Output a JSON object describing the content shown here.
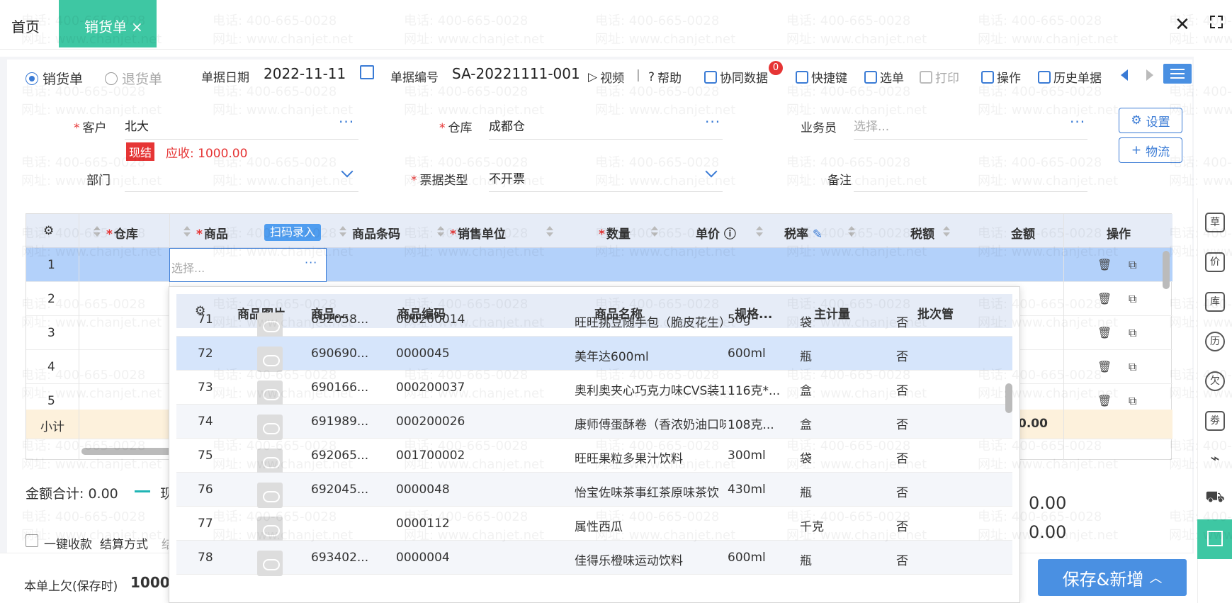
{
  "tabs": {
    "home": "首页",
    "active": "销货单",
    "close": "×"
  },
  "window": {
    "close": "✕"
  },
  "doc_type": {
    "sale": "销货单",
    "return": "退货单"
  },
  "header": {
    "date_label": "单据日期",
    "date": "2022-11-11",
    "no_label": "单据编号",
    "no": "SA-20221111-001"
  },
  "toolbar": {
    "video": "视频",
    "sep": "|",
    "help": "帮助",
    "sync": "协同数据",
    "sync_badge": "0",
    "shortcut": "快捷键",
    "pick": "选单",
    "print": "打印",
    "ops": "操作",
    "history": "历史单据"
  },
  "form": {
    "customer_label": "客户",
    "customer": "北大",
    "warehouse_label": "仓库",
    "warehouse": "成都仓",
    "salesman_label": "业务员",
    "salesman_ph": "选择...",
    "cash_tag": "现结",
    "receivable": "应收: 1000.00",
    "dept_label": "部门",
    "invoice_label": "票据类型",
    "invoice": "不开票",
    "remark_label": "备注",
    "settings_btn": "设置",
    "logistics_btn": "物流"
  },
  "grid": {
    "headers": {
      "warehouse": "仓库",
      "product": "商品",
      "barcode": "商品条码",
      "unit": "销售单位",
      "qty": "数量",
      "price": "单价",
      "tax_rate": "税率",
      "tax": "税额",
      "amount": "金额",
      "ops": "操作"
    },
    "scan_btn": "扫码录入",
    "input_ph": "选择...",
    "rows": [
      "1",
      "2",
      "3",
      "4",
      "5"
    ],
    "subtotal": "小计",
    "subtotal_amount": "0.00"
  },
  "dropdown": {
    "headers": {
      "image": "商品图片",
      "barcode": "商品...",
      "code": "商品编码",
      "name": "商品名称",
      "spec": "规格...",
      "unit": "主计量",
      "batch": "批次管"
    },
    "rows": [
      {
        "no": "71",
        "barcode": "692058...",
        "code": "000200014",
        "name": "旺旺挑豆随手包（脆皮花生）",
        "spec": "50g",
        "unit": "袋",
        "batch": "否"
      },
      {
        "no": "72",
        "barcode": "690690...",
        "code": "0000045",
        "name": "美年达600ml",
        "spec": "600ml",
        "unit": "瓶",
        "batch": "否"
      },
      {
        "no": "73",
        "barcode": "690166...",
        "code": "000200037",
        "name": "奥利奥夹心巧克力味CVS装1",
        "spec": "116克*...",
        "unit": "盒",
        "batch": "否"
      },
      {
        "no": "74",
        "barcode": "691989...",
        "code": "000200026",
        "name": "康师傅蛋酥卷（香浓奶油口味",
        "spec": "108克...",
        "unit": "盒",
        "batch": "否"
      },
      {
        "no": "75",
        "barcode": "692065...",
        "code": "001700002",
        "name": "旺旺果粒多果汁饮料",
        "spec": "300ml",
        "unit": "袋",
        "batch": "否"
      },
      {
        "no": "76",
        "barcode": "692045...",
        "code": "0000048",
        "name": "怡宝佐味茶事红茶原味茶饮",
        "spec": "430ml",
        "unit": "瓶",
        "batch": "否"
      },
      {
        "no": "77",
        "barcode": "",
        "code": "0000112",
        "name": "属性西瓜",
        "spec": "",
        "unit": "千克",
        "batch": "否"
      },
      {
        "no": "78",
        "barcode": "693402...",
        "code": "0000004",
        "name": "佳得乐橙味运动饮料",
        "spec": "600ml",
        "unit": "瓶",
        "batch": "否"
      }
    ]
  },
  "footer": {
    "total_label": "金额合计:",
    "total": "0.00",
    "total_suffix": "现",
    "one_click": "一键收款",
    "settle_label": "结算方式",
    "settle_suffix": "结",
    "arrears_label": "本单上欠(保存时)",
    "arrears": "1000",
    "right_amount1": "0.00",
    "right_amount2": "0.00",
    "save_btn": "保存&新增"
  },
  "rail": [
    "草",
    "价",
    "库",
    "历",
    "欠",
    "劵",
    "",
    "",
    ""
  ],
  "watermark": {
    "phone": "电话: 400-665-0028",
    "site": "网址: www.chanjet.net"
  }
}
